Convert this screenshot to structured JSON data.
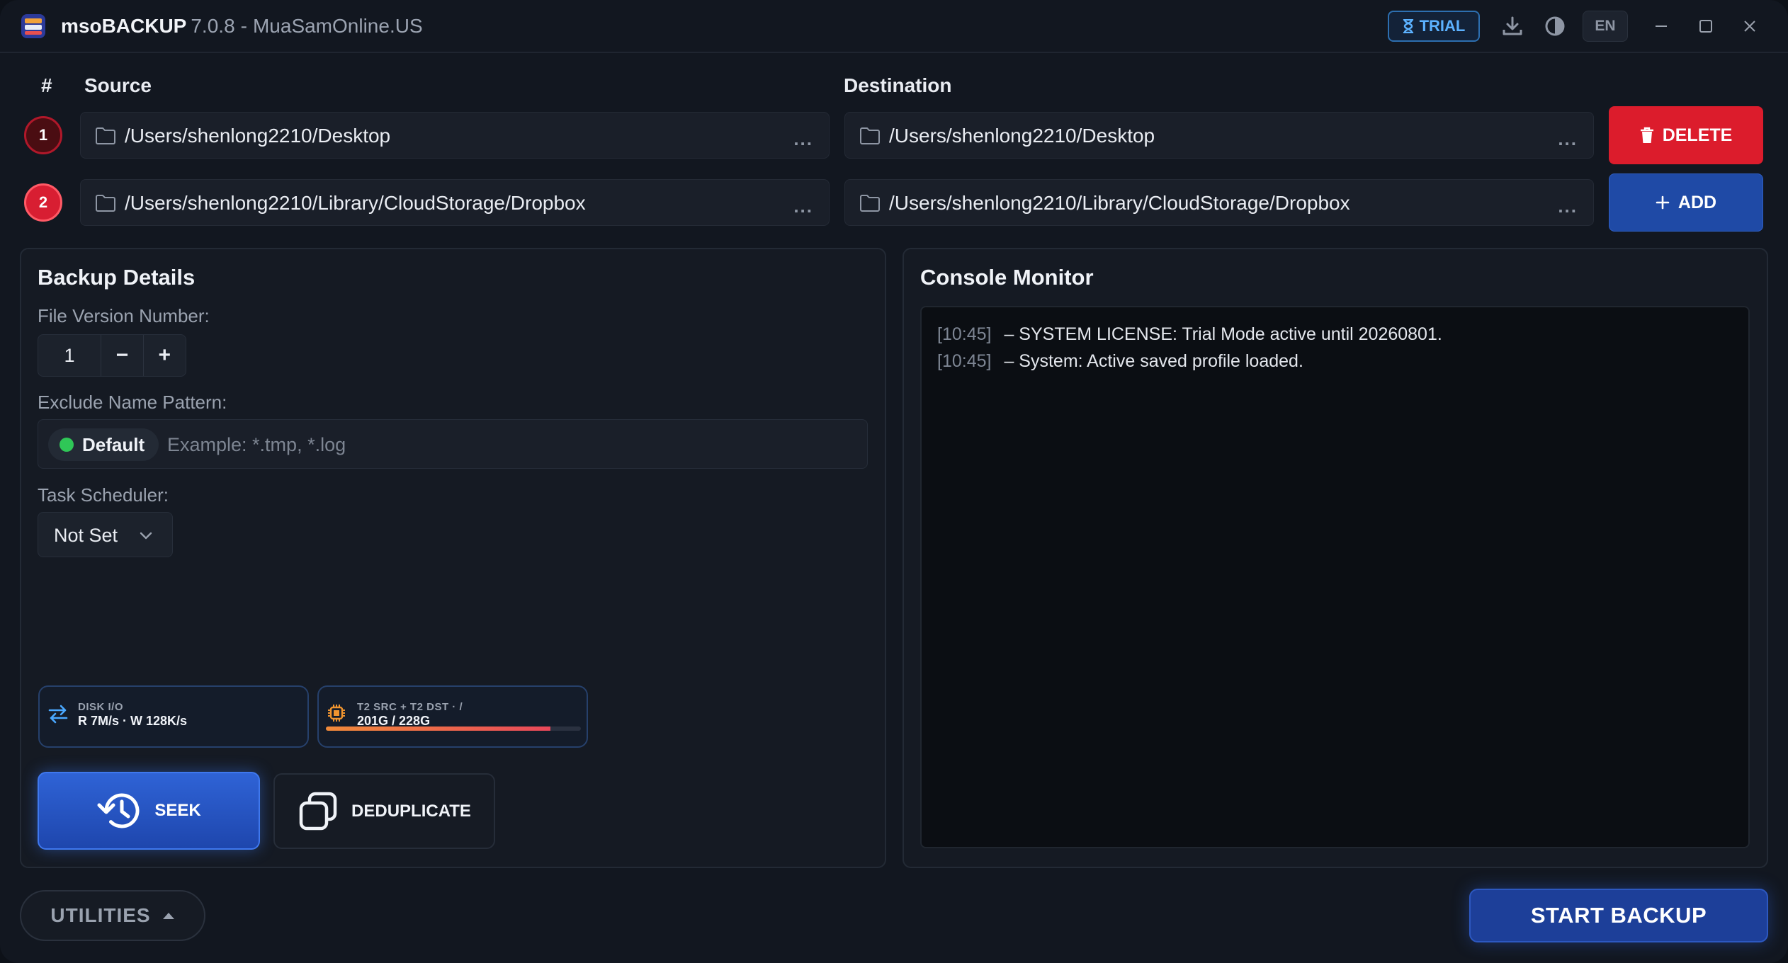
{
  "app": {
    "name": "msoBACKUP",
    "version": "7.0.8",
    "separator": "-",
    "site": "MuaSamOnline.US"
  },
  "titlebar": {
    "trial_label": "TRIAL",
    "lang": "EN"
  },
  "columns": {
    "index": "#",
    "source": "Source",
    "destination": "Destination"
  },
  "rows": [
    {
      "number": "1",
      "source": "/Users/shenlong2210/Desktop",
      "destination": "/Users/shenlong2210/Desktop",
      "more": "..."
    },
    {
      "number": "2",
      "source": "/Users/shenlong2210/Library/CloudStorage/Dropbox",
      "destination": "/Users/shenlong2210/Library/CloudStorage/Dropbox",
      "more": "..."
    }
  ],
  "actions": {
    "delete_label": "DELETE",
    "add_label": "ADD"
  },
  "backup_details": {
    "title": "Backup Details",
    "version_label": "File Version Number:",
    "version_value": "1",
    "minus": "−",
    "plus": "+",
    "exclude_label": "Exclude Name Pattern:",
    "exclude_chip": "Default",
    "exclude_placeholder": "Example: *.tmp, *.log",
    "scheduler_label": "Task Scheduler:",
    "scheduler_value": "Not Set"
  },
  "stats": {
    "disk": {
      "label": "DISK I/O",
      "value": "R 7M/s · W 128K/s"
    },
    "storage": {
      "label": "T2 SRC + T2 DST · /",
      "value": "201G / 228G",
      "fill_fraction": 0.88
    }
  },
  "tools": {
    "seek_label": "SEEK",
    "dedup_label": "DEDUPLICATE"
  },
  "console": {
    "title": "Console Monitor",
    "lines": [
      {
        "time": "[10:45]",
        "text": "– SYSTEM LICENSE: Trial Mode active until 20260801."
      },
      {
        "time": "[10:45]",
        "text": "– System: Active saved profile loaded."
      }
    ]
  },
  "footer": {
    "utilities_label": "UTILITIES",
    "start_label": "START BACKUP"
  },
  "colors": {
    "accent_blue": "#1f4aa6",
    "danger_red": "#dc1c2c",
    "success_green": "#2fc757",
    "trial_blue": "#5cb2ff"
  }
}
